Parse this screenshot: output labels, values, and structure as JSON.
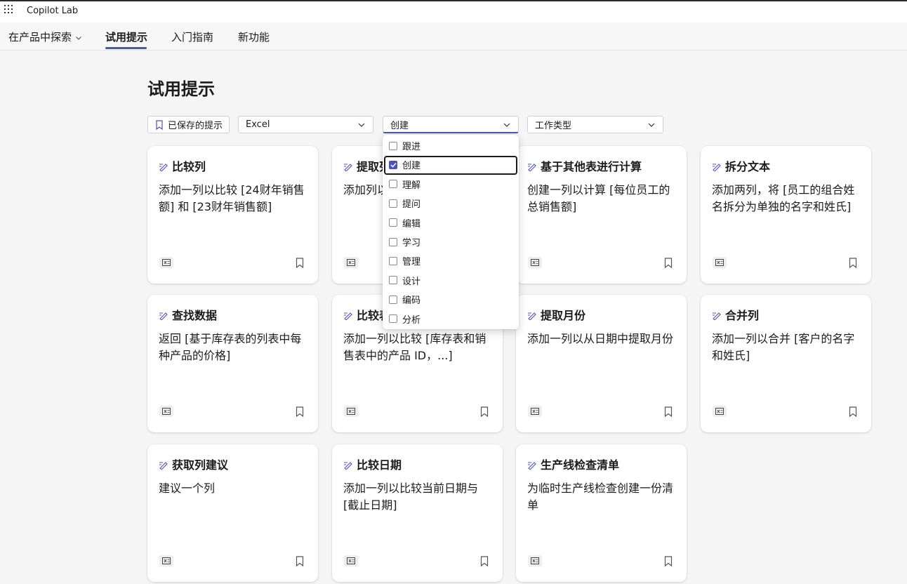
{
  "app": {
    "title": "Copilot Lab"
  },
  "nav": {
    "explore": "在产品中探索",
    "try_prompts": "试用提示",
    "getting_started": "入门指南",
    "whats_new": "新功能"
  },
  "page": {
    "title": "试用提示"
  },
  "filters": {
    "saved": "已保存的提示",
    "app_value": "Excel",
    "task_value": "创建",
    "job_placeholder": "工作类型"
  },
  "task_options": [
    {
      "label": "跟进",
      "checked": false
    },
    {
      "label": "创建",
      "checked": true
    },
    {
      "label": "理解",
      "checked": false
    },
    {
      "label": "提问",
      "checked": false
    },
    {
      "label": "编辑",
      "checked": false
    },
    {
      "label": "学习",
      "checked": false
    },
    {
      "label": "管理",
      "checked": false
    },
    {
      "label": "设计",
      "checked": false
    },
    {
      "label": "编码",
      "checked": false
    },
    {
      "label": "分析",
      "checked": false
    }
  ],
  "cards": [
    {
      "title": "比较列",
      "desc": "添加一列以比较 [24财年销售额] 和 [23财年销售额]"
    },
    {
      "title": "提取列",
      "desc": "添加列以提取州，和地址"
    },
    {
      "title": "基于其他表进行计算",
      "desc": "创建一列以计算 [每位员工的总销售额]"
    },
    {
      "title": "拆分文本",
      "desc": "添加两列，将 [员工的组合姓名拆分为单独的名字和姓氏]"
    },
    {
      "title": "查找数据",
      "desc": "返回 [基于库存表的列表中每种产品的价格]"
    },
    {
      "title": "比较表",
      "desc": "添加一列以比较 [库存表和销售表中的产品 ID，...]"
    },
    {
      "title": "提取月份",
      "desc": "添加一列以从日期中提取月份"
    },
    {
      "title": "合并列",
      "desc": "添加一列以合并 [客户的名字和姓氏]"
    },
    {
      "title": "获取列建议",
      "desc": "建议一个列"
    },
    {
      "title": "比较日期",
      "desc": "添加一列以比较当前日期与 [截止日期]"
    },
    {
      "title": "生产线检查清单",
      "desc": "为临时生产线检查创建一份清单"
    }
  ],
  "colors": {
    "accent": "#4b53bc",
    "text": "#1b1b1b",
    "background": "#f5f5f5"
  },
  "icons": {
    "card_prompt": "pen-sparkle-icon",
    "card_app": "excel-icon",
    "card_save": "bookmark-icon"
  }
}
